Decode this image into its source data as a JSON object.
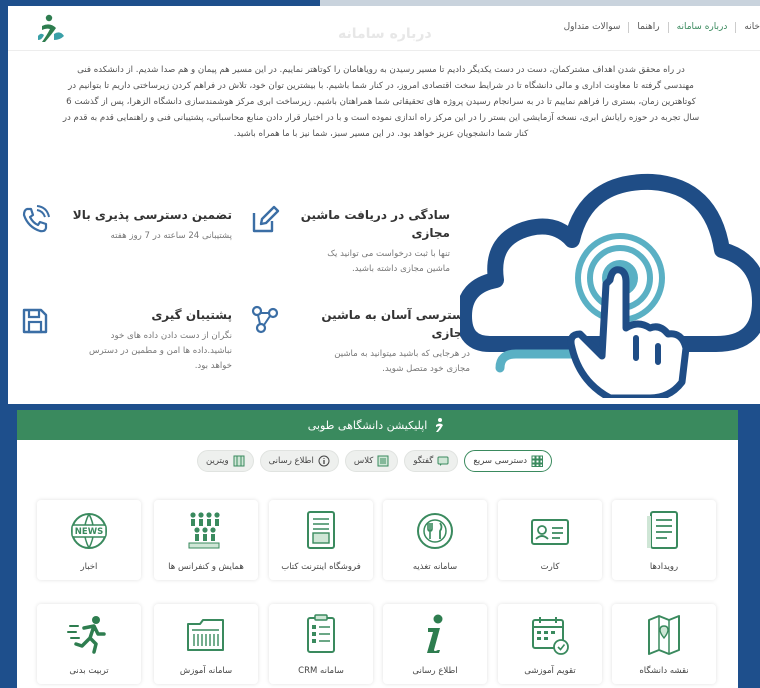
{
  "nav": {
    "links": [
      "خانه",
      "درباره سامانه",
      "راهنما",
      "سوالات متداول"
    ],
    "ghost_title": "درباره سامانه"
  },
  "about": {
    "lines": [
      "در راه محقق شدن اهداف مشترکمان، دست در دست یکدیگر دادیم تا مسیر رسیدن به رویاهامان را کوتاهتر نماییم. در این مسیر هم پیمان و هم صدا شدیم. از دانشکده فنی",
      "مهندسی گرفته تا معاونت اداری و مالی دانشگاه تا در شرایط سخت اقتصادی امروز، در کنار شما باشیم. با بیشترین توان خود، تلاش در فراهم کردن زیرساختی داریم تا بتوانیم در",
      "کوتاهترین زمان، بستری را فراهم نماییم تا در به سرانجام رسیدن پروژه های تحقیقاتی شما همراهتان باشیم. زیرساخت ابری مرکز هوشمندسازی دانشگاه الزهرا، پس از گذشت 6",
      "سال تجربه در حوزه رایانش ابری، نسخه آزمایشی این بستر را در این مرکز راه اندازی نموده است و با در اختیار قرار دادن منابع محاسباتی، پشتیبانی فنی و راهنمایی قدم به قدم در",
      "کنار شما دانشجویان عزیز خواهد بود. در این مسیر سبز، شما نیز با ما همراه باشید."
    ]
  },
  "features": [
    {
      "title": "سادگی در دریافت ماشین مجازی",
      "desc": [
        "تنها با ثبت درخواست می توانید یک",
        "ماشین مجازی داشته باشید."
      ]
    },
    {
      "title": "تضمین دسترسی پذیری بالا",
      "desc": [
        "پشتیبانی 24 ساعته در 7 روز هفته"
      ]
    },
    {
      "title": "دسترسی آسان به ماشین مجازی",
      "desc": [
        "در هرجایی که باشید میتوانید به ماشین",
        "مجازی خود متصل شوید."
      ]
    },
    {
      "title": "پشتیبان گیری",
      "desc": [
        "نگران از دست دادن داده های خود",
        "نباشید.داده ها امن و مطمین در دسترس",
        "خواهد بود."
      ]
    }
  ],
  "app": {
    "title": "اپلیکیشن دانشگاهی طوبی",
    "chips": [
      "دسترسی سریع",
      "گفتگو",
      "کلاس",
      "اطلاع رسانی",
      "ویترین"
    ],
    "row1": [
      "رویدادها",
      "کارت",
      "سامانه تغذیه",
      "فروشگاه اینترنت کتاب",
      "همایش و کنفرانس ها",
      "اخبار"
    ],
    "row2": [
      "نقشه دانشگاه",
      "تقویم آموزشی",
      "اطلاع رسانی",
      "سامانه CRM",
      "سامانه آموزش",
      "تربیت بدنی"
    ],
    "news_icon_text": "NEWS"
  },
  "colors": {
    "green": "#3a8a5e",
    "blue_icon": "#3b6ea5",
    "frame_blue": "#1e4f8c"
  },
  "icons": {
    "features": [
      "edit-icon",
      "phone-icon",
      "share-network-icon",
      "save-icon"
    ],
    "chips": [
      "grid-icon",
      "chat-icon",
      "class-icon",
      "info-icon",
      "store-icon"
    ],
    "row1": [
      "document-icon",
      "id-card-icon",
      "food-icon",
      "book-store-icon",
      "conference-icon",
      "news-globe-icon"
    ],
    "row2": [
      "map-icon",
      "calendar-icon",
      "info-i-icon",
      "checklist-icon",
      "folder-icon",
      "runner-icon"
    ]
  }
}
